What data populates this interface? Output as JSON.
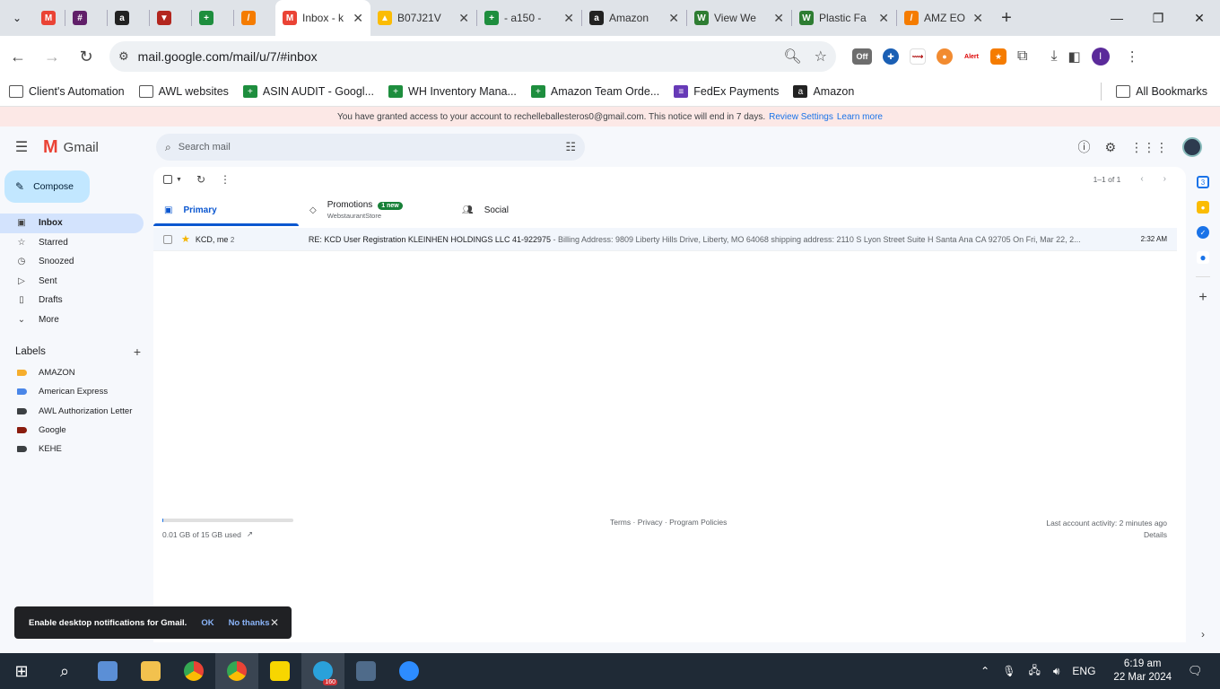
{
  "browser": {
    "tabs": [
      {
        "label": "",
        "favicon": "gmail-icon",
        "color": "#ea4335"
      },
      {
        "label": "",
        "favicon": "slack-icon",
        "color": "#611f69"
      },
      {
        "label": "",
        "favicon": "amazon-icon",
        "color": "#222222"
      },
      {
        "label": "",
        "favicon": "shield-icon",
        "color": "#b3261e"
      },
      {
        "label": "",
        "favicon": "sheets-icon",
        "color": "#1e8e3e"
      },
      {
        "label": "",
        "favicon": "tool-icon",
        "color": "#f57c00"
      },
      {
        "label": "Inbox - k",
        "favicon": "gmail-icon",
        "color": "#ea4335",
        "active": true
      },
      {
        "label": "B07J21V",
        "favicon": "drive-icon",
        "color": "#fbbc04"
      },
      {
        "label": "- a150 -",
        "favicon": "sheets-icon",
        "color": "#1e8e3e"
      },
      {
        "label": "Amazon",
        "favicon": "amazon-icon",
        "color": "#222222"
      },
      {
        "label": "View We",
        "favicon": "webstaurant-icon",
        "color": "#2e7d32"
      },
      {
        "label": "Plastic Fa",
        "favicon": "webstaurant-icon",
        "color": "#2e7d32"
      },
      {
        "label": "AMZ EO",
        "favicon": "tool-icon",
        "color": "#f57c00"
      }
    ],
    "url": "mail.google.com/mail/u/7/#inbox",
    "profile_initial": "I",
    "ext_off_label": "Off",
    "ext_alert_label": "Alert"
  },
  "bookmarks": [
    {
      "label": "Client's Automation",
      "icon": "folder-icon"
    },
    {
      "label": "AWL websites",
      "icon": "folder-icon"
    },
    {
      "label": "ASIN AUDIT - Googl...",
      "icon": "sheets-icon"
    },
    {
      "label": "WH Inventory Mana...",
      "icon": "sheets-icon"
    },
    {
      "label": "Amazon Team Orde...",
      "icon": "sheets-icon"
    },
    {
      "label": "FedEx Payments",
      "icon": "forms-icon"
    },
    {
      "label": "Amazon",
      "icon": "amazon-icon"
    }
  ],
  "all_bookmarks": "All Bookmarks",
  "notice": {
    "text": "You have granted access to your account to rechelleballesteros0@gmail.com. This notice will end in 7 days.",
    "review": "Review Settings",
    "learn": "Learn more"
  },
  "gmail": {
    "app_name": "Gmail",
    "search_placeholder": "Search mail",
    "compose": "Compose",
    "nav": [
      {
        "label": "Inbox",
        "icon": "inbox-icon",
        "active": true
      },
      {
        "label": "Starred",
        "icon": "star-icon"
      },
      {
        "label": "Snoozed",
        "icon": "clock-icon"
      },
      {
        "label": "Sent",
        "icon": "send-icon"
      },
      {
        "label": "Drafts",
        "icon": "draft-icon"
      },
      {
        "label": "More",
        "icon": "chevron-down-icon"
      }
    ],
    "labels_title": "Labels",
    "labels": [
      {
        "label": "AMAZON",
        "color": "#f6ae2d"
      },
      {
        "label": "American Express",
        "color": "#4a86e8"
      },
      {
        "label": "AWL Authorization Letter",
        "color": "#3c4043"
      },
      {
        "label": "Google",
        "color": "#8a1c0e"
      },
      {
        "label": "KEHE",
        "color": "#3c4043"
      }
    ],
    "pager": "1–1 of 1",
    "tabs": {
      "primary": "Primary",
      "promotions": "Promotions",
      "promotions_badge": "1 new",
      "promotions_sub": "WebstaurantStore",
      "social": "Social"
    },
    "email": {
      "from": "KCD, me",
      "count": "2",
      "subject": "RE: KCD User Registration KLEINHEN HOLDINGS LLC 41-922975",
      "snippet": " - Billing Address: 9809 Liberty Hills Drive, Liberty, MO 64068 shipping address: 2110 S Lyon Street Suite H Santa Ana CA 92705 On Fri, Mar 22, 2...",
      "time": "2:32 AM"
    },
    "storage": "0.01 GB of 15 GB used",
    "storage_fraction": 0.001,
    "footer_links": "Terms · Privacy · Program Policies",
    "activity": "Last account activity: 2 minutes ago",
    "details": "Details"
  },
  "snackbar": {
    "text": "Enable desktop notifications for Gmail.",
    "ok": "OK",
    "no": "No thanks"
  },
  "taskbar": {
    "telegram_badge": "160",
    "lang": "ENG",
    "time": "6:19 am",
    "date": "22 Mar 2024"
  }
}
